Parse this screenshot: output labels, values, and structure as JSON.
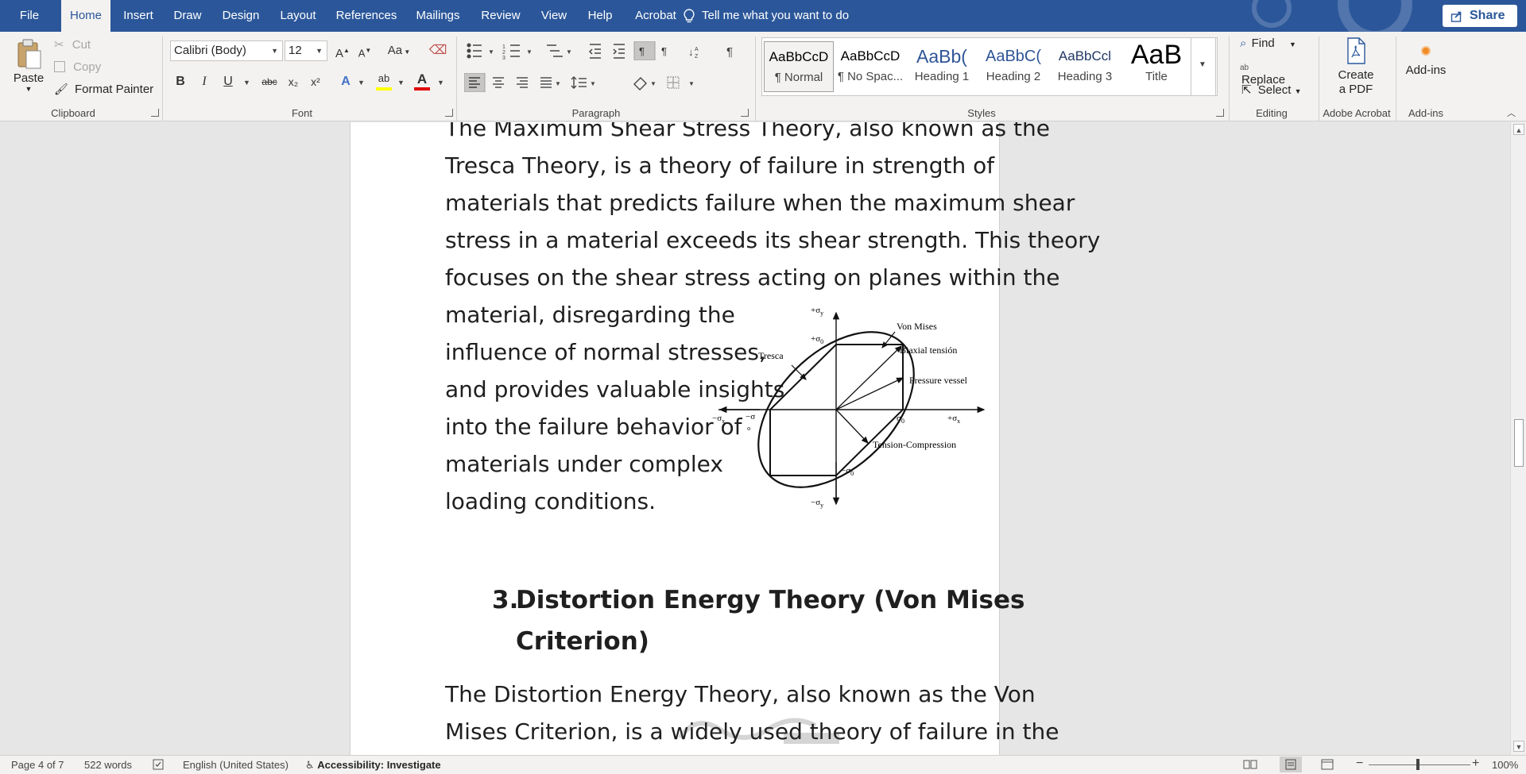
{
  "tabs": [
    "File",
    "Home",
    "Insert",
    "Draw",
    "Design",
    "Layout",
    "References",
    "Mailings",
    "Review",
    "View",
    "Help",
    "Acrobat"
  ],
  "active_tab": "Home",
  "tell_me": "Tell me what you want to do",
  "share_label": "Share",
  "clipboard": {
    "paste": "Paste",
    "cut": "Cut",
    "copy": "Copy",
    "format_painter": "Format Painter",
    "label": "Clipboard"
  },
  "font": {
    "name": "Calibri (Body)",
    "size": "12",
    "label": "Font",
    "bold": "B",
    "italic": "I",
    "underline": "U",
    "strike": "abc",
    "subscript": "x₂",
    "superscript": "x²",
    "grow": "A",
    "shrink": "A",
    "case": "Aa",
    "highlight_color": "#ffff00",
    "font_color": "#e00000"
  },
  "paragraph": {
    "label": "Paragraph"
  },
  "styles": {
    "label": "Styles",
    "items": [
      {
        "sample": "AaBbCcD",
        "name": "¶ Normal"
      },
      {
        "sample": "AaBbCcD",
        "name": "¶ No Spac..."
      },
      {
        "sample": "AaBb(",
        "name": "Heading 1"
      },
      {
        "sample": "AaBbC(",
        "name": "Heading 2"
      },
      {
        "sample": "AaBbCcl",
        "name": "Heading 3"
      },
      {
        "sample": "AaB",
        "name": "Title"
      }
    ]
  },
  "editing": {
    "label": "Editing",
    "find": "Find",
    "replace": "Replace",
    "select": "Select"
  },
  "acrobat": {
    "label": "Adobe Acrobat",
    "create_line1": "Create",
    "create_line2": "a PDF"
  },
  "addins": {
    "label": "Add-ins",
    "button": "Add-ins"
  },
  "document": {
    "para1_lines": [
      "The Maximum Shear Stress Theory, also known as the",
      "Tresca Theory, is a theory of failure in strength of",
      "materials that predicts failure when the maximum shear",
      "stress in a material exceeds its shear strength. This theory",
      "focuses on the shear stress acting on planes within the",
      "material, disregarding the",
      "influence of normal stresses,",
      "and provides valuable insights",
      "into the failure behavior of",
      "materials under complex",
      "loading conditions."
    ],
    "heading_number": "3.",
    "heading_line1": "Distortion Energy Theory (Von Mises",
    "heading_line2": "Criterion)",
    "para2_lines": [
      "The Distortion Energy Theory, also known as the Von",
      "Mises Criterion, is a widely used theory of failure in the"
    ],
    "figure_labels": {
      "plus_sy": "+σ",
      "plus_sy_sub": "y",
      "plus_s0": "+σ",
      "plus_s0_sub": "0",
      "von_mises": "Von Mises",
      "tresca": "Tresca",
      "biaxial": "Biaxial tensión",
      "pressure": "Pressure vessel",
      "minus_sx": "−σ",
      "minus_sx_sub": "x",
      "minus_s": "−σ",
      "minus_s_sub": "o",
      "s0": "σ",
      "s0_sub": "0",
      "plus_sx": "+σ",
      "plus_sx_sub": "x",
      "tension_comp": "Tension-Compression",
      "minus_s0": "−σ",
      "minus_s0_sub": "0",
      "minus_sy": "−σ",
      "minus_sy_sub": "y"
    }
  },
  "status": {
    "page": "Page 4 of 7",
    "words": "522 words",
    "language": "English (United States)",
    "accessibility": "Accessibility: Investigate",
    "zoom": "100%"
  }
}
